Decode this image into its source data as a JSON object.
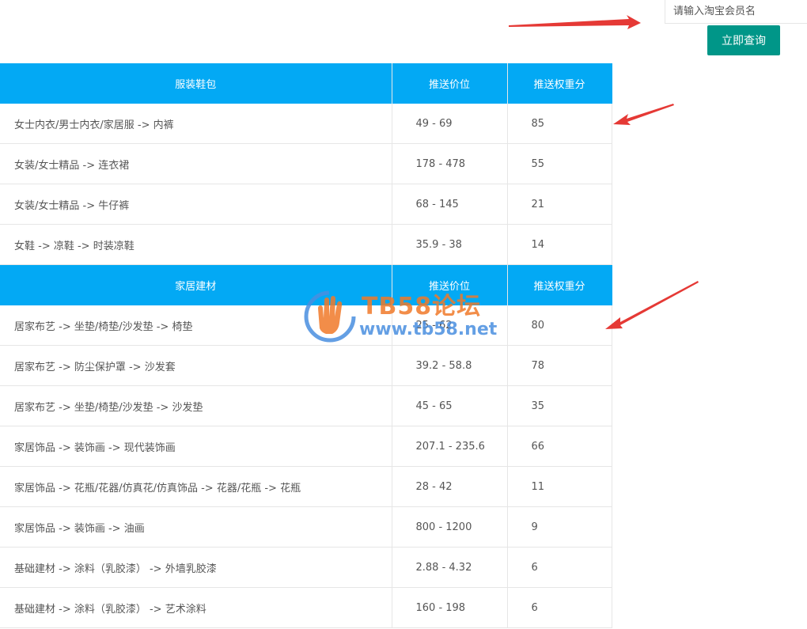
{
  "search": {
    "placeholder": "请输入淘宝会员名",
    "button_label": "立即查询"
  },
  "colors": {
    "header_bg": "#03a9f4",
    "button_bg": "#009688",
    "arrow": "#e53935"
  },
  "sections": [
    {
      "headers": [
        "服装鞋包",
        "推送价位",
        "推送权重分"
      ],
      "rows": [
        {
          "category": "女士内衣/男士内衣/家居服 -> 内裤",
          "price": "49 - 69",
          "weight": "85"
        },
        {
          "category": "女装/女士精品 -> 连衣裙",
          "price": "178 - 478",
          "weight": "55"
        },
        {
          "category": "女装/女士精品 -> 牛仔裤",
          "price": "68 - 145",
          "weight": "21"
        },
        {
          "category": "女鞋 -> 凉鞋 -> 时装凉鞋",
          "price": "35.9 - 38",
          "weight": "14"
        }
      ]
    },
    {
      "headers": [
        "家居建材",
        "推送价位",
        "推送权重分"
      ],
      "rows": [
        {
          "category": "居家布艺 -> 坐垫/椅垫/沙发垫 -> 椅垫",
          "price": "25 - 62",
          "weight": "80"
        },
        {
          "category": "居家布艺 -> 防尘保护罩 -> 沙发套",
          "price": "39.2 - 58.8",
          "weight": "78"
        },
        {
          "category": "居家布艺 -> 坐垫/椅垫/沙发垫 -> 沙发垫",
          "price": "45 - 65",
          "weight": "35"
        },
        {
          "category": "家居饰品 -> 装饰画 -> 现代装饰画",
          "price": "207.1 - 235.6",
          "weight": "66"
        },
        {
          "category": "家居饰品 -> 花瓶/花器/仿真花/仿真饰品 -> 花器/花瓶 -> 花瓶",
          "price": "28 - 42",
          "weight": "11"
        },
        {
          "category": "家居饰品 -> 装饰画 -> 油画",
          "price": "800 - 1200",
          "weight": "9"
        },
        {
          "category": "基础建材 -> 涂料（乳胶漆） -> 外墙乳胶漆",
          "price": "2.88 - 4.32",
          "weight": "6"
        },
        {
          "category": "基础建材 -> 涂料（乳胶漆） -> 艺术涂料",
          "price": "160 - 198",
          "weight": "6"
        }
      ]
    }
  ],
  "watermark": {
    "title": "TB58论坛",
    "url": "www.tb58.net",
    "icon": "hand-logo-icon"
  }
}
